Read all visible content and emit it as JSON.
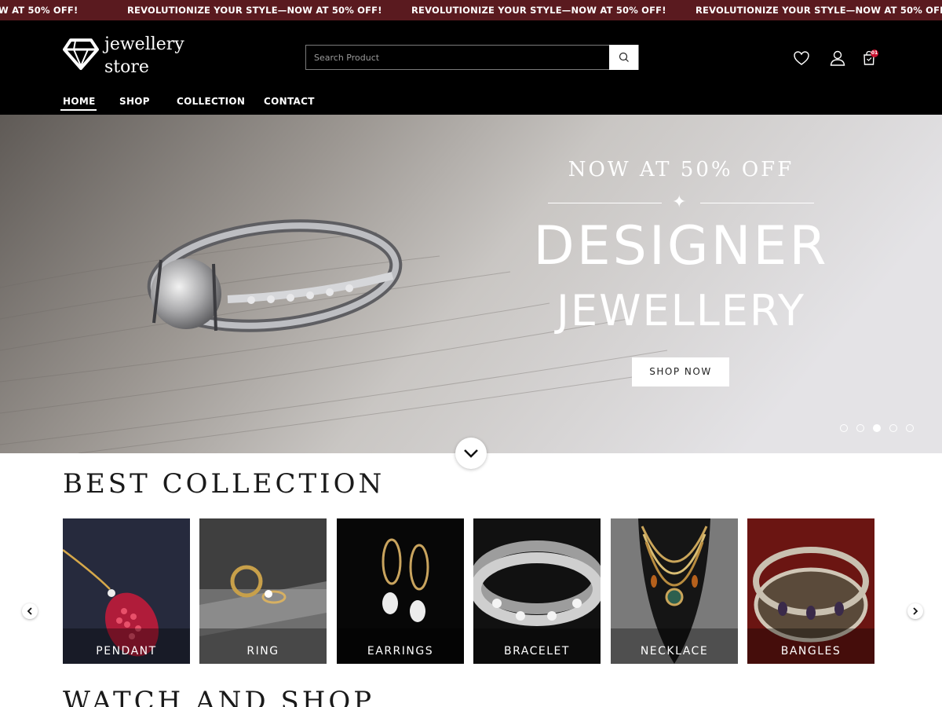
{
  "promo": {
    "items": [
      "W AT 50% OFF!",
      "REVOLUTIONIZE YOUR STYLE—NOW AT 50% OFF!",
      "REVOLUTIONIZE YOUR STYLE—NOW AT 50% OFF!",
      "REVOLUTIONIZE YOUR STYLE—NOW AT 50% OFF!"
    ]
  },
  "header": {
    "logo_line1": "jewellery",
    "logo_line2": "store",
    "search_placeholder": "Search Product",
    "cart_count": "01",
    "nav": [
      "HOME",
      "SHOP",
      "COLLECTION",
      "CONTACT"
    ],
    "active_nav": "HOME"
  },
  "hero": {
    "subtitle": "NOW AT 50% OFF",
    "title_line1": "DESIGNER",
    "title_line2": "JEWELLERY",
    "cta": "SHOP NOW",
    "slides": 5,
    "active_slide": 3
  },
  "collection": {
    "title": "BEST COLLECTION",
    "items": [
      "PENDANT",
      "RING",
      "EARRINGS",
      "BRACELET",
      "NECKLACE",
      "BANGLES"
    ]
  },
  "next_section": {
    "title": "WATCH AND SHOP"
  },
  "colors": {
    "promo_bg": "#5a1a1f",
    "header_bg": "#000000",
    "badge": "#c8102e"
  }
}
